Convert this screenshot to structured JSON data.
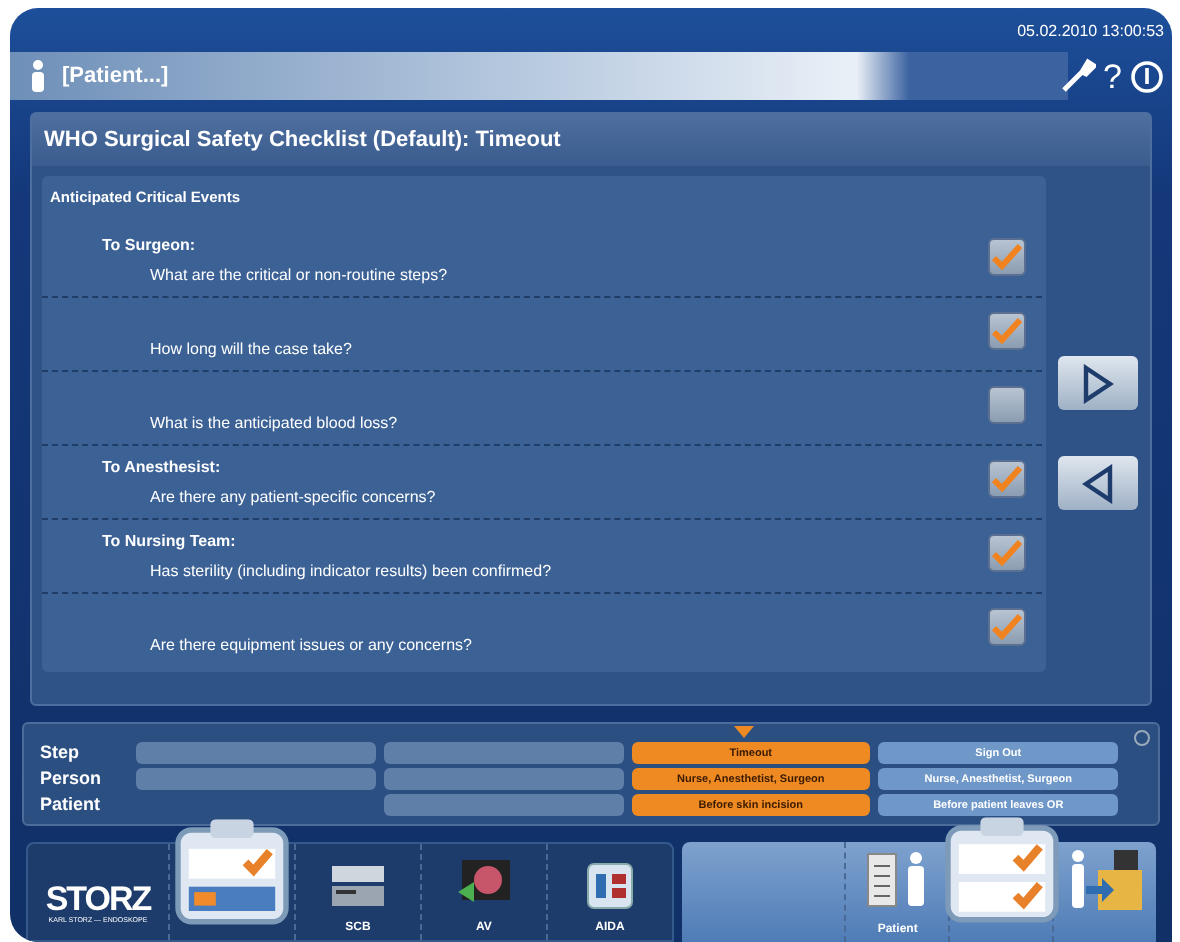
{
  "header": {
    "datetime": "05.02.2010 13:00:53",
    "patient": "[Patient...]",
    "help": "?"
  },
  "title": "WHO Surgical Safety Checklist (Default): Timeout",
  "checklist": {
    "section": "Anticipated Critical Events",
    "groups": [
      {
        "label": "To Surgeon:",
        "items": [
          {
            "text": "What are the critical or non-routine steps?",
            "checked": true
          },
          {
            "text": "How long will the case take?",
            "checked": true
          },
          {
            "text": "What is the anticipated blood loss?",
            "checked": false
          }
        ]
      },
      {
        "label": "To Anesthesist:",
        "items": [
          {
            "text": "Are there any patient-specific concerns?",
            "checked": true
          }
        ]
      },
      {
        "label": "To Nursing Team:",
        "items": [
          {
            "text": "Has sterility (including indicator results) been confirmed?",
            "checked": true
          },
          {
            "text": "Are there equipment issues or any concerns?",
            "checked": true
          }
        ]
      }
    ]
  },
  "nav_buttons": [
    {
      "kind": "next"
    },
    {
      "kind": "back"
    }
  ],
  "steps": {
    "row_labels": [
      "Step",
      "Person",
      "Patient"
    ],
    "columns": [
      {
        "selected": false,
        "completed": true,
        "cells": [
          {
            "text": ""
          },
          {
            "text": ""
          },
          null
        ]
      },
      {
        "selected": false,
        "completed": true,
        "cells": [
          {
            "text": ""
          },
          {
            "text": ""
          },
          {
            "text": ""
          }
        ]
      },
      {
        "selected": true,
        "completed": false,
        "cells": [
          {
            "text": "Timeout"
          },
          {
            "text": "Nurse, Anesthetist, Surgeon"
          },
          {
            "text": "Before skin incision"
          }
        ]
      },
      {
        "selected": false,
        "completed": false,
        "cells": [
          {
            "text": "Sign Out"
          },
          {
            "text": "Nurse, Anesthetist, Surgeon"
          },
          {
            "text": "Before patient leaves OR"
          }
        ]
      }
    ]
  },
  "logo": {
    "brand": "STORZ",
    "tagline": "KARL STORZ — ENDOSKOPE"
  },
  "dock_left": [
    {
      "kind": "case",
      "selected": true
    },
    {
      "kind": "scb",
      "label": "SCB",
      "selected": false
    },
    {
      "kind": "av",
      "label": "AV",
      "selected": false
    },
    {
      "kind": "aida",
      "label": "AIDA",
      "selected": false
    }
  ],
  "dock_right": [
    {
      "kind": "patient",
      "label": "Patient",
      "selected": false
    },
    {
      "kind": "checklist",
      "selected": true
    },
    {
      "kind": "leave",
      "selected": false
    }
  ]
}
